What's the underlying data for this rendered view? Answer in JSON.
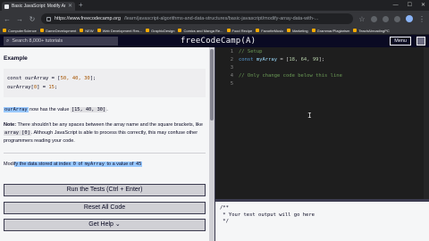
{
  "browser": {
    "tab_title": "Basic JavaScript: Modify Arra...",
    "url_host": "https://www.freecodecamp.org",
    "url_path": "/learn/javascript-algorithms-and-data-structures/basic-javascript/modify-array-data-with-...",
    "bookmarks": [
      "ComputerScience",
      "GameDevelopment",
      "NEW",
      "Web Development Res...",
      "GraphicDesign",
      "Comics and Manga Re...",
      "Food Recipe",
      "FavoriteMusic",
      "Marketing",
      "Grammar/Plagiarism",
      "TeachAbroadingPC"
    ]
  },
  "navbar": {
    "search_placeholder": "Search 8,000+ tutorials",
    "logo": "freeCodeCamp(A)",
    "menu_label": "Menu"
  },
  "instructions": {
    "example_heading": "Example",
    "example_code": {
      "line1_pre": "const ourArray = [",
      "line1_nums": "50, 40, 30",
      "line1_post": "];",
      "line2_pre": "ourArray[",
      "line2_idx": "0",
      "line2_mid": "] = ",
      "line2_val": "15",
      "line2_post": ";"
    },
    "result_code": "ourArray",
    "result_text": " now has the value ",
    "result_value": "[15, 40, 30]",
    "result_end": ".",
    "note_label": "Note:",
    "note_text1": " There shouldn't be any spaces between the array name and the square brackets, like ",
    "note_code": "array [0]",
    "note_text2": ". Although JavaScript is able to process this correctly, this may confuse other programmers reading your code.",
    "task_pre": "Modi",
    "task_sel1": "fy the data stored at index ",
    "task_code1": "0",
    "task_sel2": " of ",
    "task_code2": "myArray",
    "task_sel3": " to a value of ",
    "task_code3": "45"
  },
  "buttons": {
    "run": "Run the Tests (Ctrl + Enter)",
    "reset": "Reset All Code",
    "help": "Get Help ⌄"
  },
  "editor": {
    "line_numbers": [
      "1",
      "2",
      "3",
      "4",
      "5"
    ],
    "line1": "// Setup",
    "line2_kw": "const",
    "line2_var": " myArray",
    "line2_eq": " = [",
    "line2_n1": "18",
    "line2_c1": ", ",
    "line2_n2": "64",
    "line2_c2": ", ",
    "line2_n3": "99",
    "line2_end": "];",
    "line4": "// Only change code below this line"
  },
  "output": {
    "text": "/**\n * Your test output will go here\n */"
  }
}
